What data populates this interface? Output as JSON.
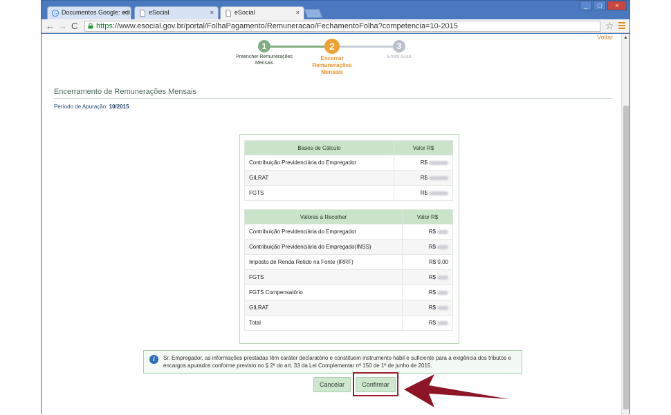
{
  "browser": {
    "tabs": [
      {
        "label": "Documentos Google: edi",
        "icon": "google-icon"
      },
      {
        "label": "eSocial",
        "icon": "page-icon"
      },
      {
        "label": "eSocial",
        "icon": "page-icon"
      }
    ],
    "url_scheme": "https",
    "url_rest": "://www.esocial.gov.br/portal/FolhaPagamento/Remuneracao/FechamentoFolha?competencia=10-2015",
    "window_buttons": [
      "_",
      "□",
      "×"
    ]
  },
  "page": {
    "voltar": "Voltar",
    "steps": [
      {
        "number": "1",
        "label": "Preencher Remunerações Mensais",
        "state": "done",
        "color": "#7faf7f"
      },
      {
        "number": "2",
        "label": "Encerrar Remunerações Mensais",
        "state": "active",
        "color": "#f0a030"
      },
      {
        "number": "3",
        "label": "Emitir Guia",
        "state": "pending",
        "color": "#b8c2cc"
      }
    ],
    "title": "Encerramento de Remunerações Mensais",
    "period_label": "Período de Apuração:",
    "period_value": "10/2015",
    "bases": {
      "headers": [
        "Bases de Cálculo",
        "Valor R$"
      ],
      "rows": [
        {
          "label": "Contribuição Previdenciária do Empregador",
          "value": "R$"
        },
        {
          "label": "GILRAT",
          "value": "R$"
        },
        {
          "label": "FGTS",
          "value": "R$"
        }
      ]
    },
    "valores": {
      "headers": [
        "Valores a Recolher",
        "Valor R$"
      ],
      "rows": [
        {
          "label": "Contribuição Previdenciária do Empregador",
          "value": "R$"
        },
        {
          "label": "Contribuição Previdenciária do Empregado(INSS)",
          "value": "R$"
        },
        {
          "label": "Imposto de Renda Retido na Fonte (IRRF)",
          "value": "R$ 0,00"
        },
        {
          "label": "FGTS",
          "value": "R$"
        },
        {
          "label": "FGTS Compensatório",
          "value": "R$"
        },
        {
          "label": "GILRAT",
          "value": "R$"
        },
        {
          "label": "Total",
          "value": "R$"
        }
      ]
    },
    "info_text": "Sr. Empregador, as informações prestadas têm caráter declaratório e constituem instrumento hábil e suficiente para a exigência dos tributos e encargos apurados conforme previsto no § 2º do art. 33 da Lei Complementar nº 150 de 1º de junho de 2015.",
    "cancel_label": "Cancelar",
    "confirm_label": "Confirmar",
    "annotation_color": "#9d1b2a"
  }
}
